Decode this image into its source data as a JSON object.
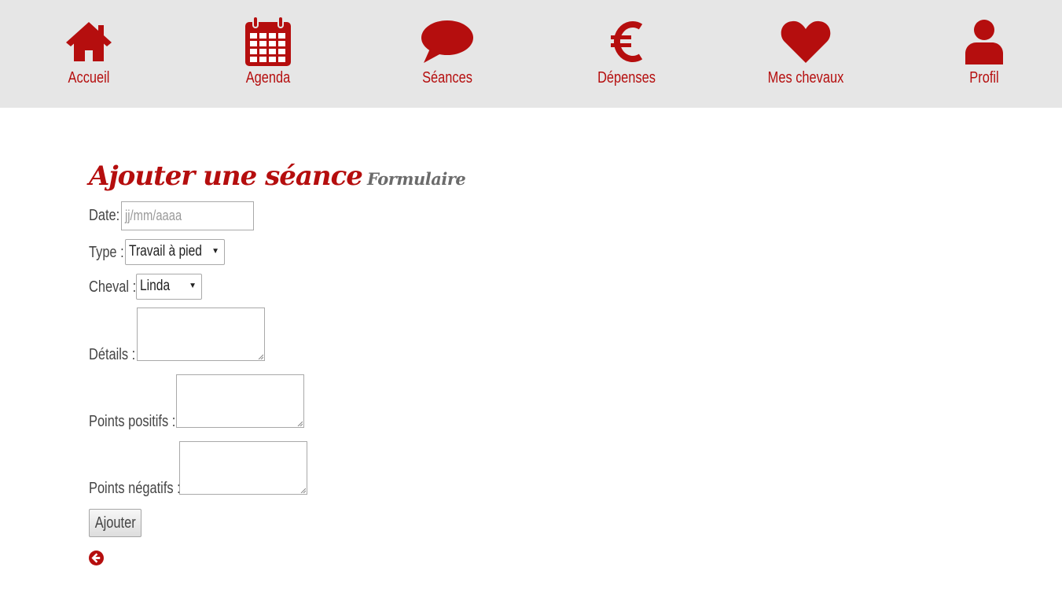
{
  "nav": {
    "items": [
      {
        "label": "Accueil",
        "icon": "home-icon"
      },
      {
        "label": "Agenda",
        "icon": "calendar-icon"
      },
      {
        "label": "Séances",
        "icon": "speech-bubble-icon"
      },
      {
        "label": "Dépenses",
        "icon": "euro-icon"
      },
      {
        "label": "Mes chevaux",
        "icon": "heart-icon"
      },
      {
        "label": "Profil",
        "icon": "user-icon"
      }
    ]
  },
  "page": {
    "title": "Ajouter une séance",
    "subtitle": "Formulaire"
  },
  "form": {
    "date_label": "Date:",
    "date_placeholder": "jj/mm/aaaa",
    "type_label": "Type :",
    "type_value": "Travail à pied",
    "cheval_label": "Cheval :",
    "cheval_value": "Linda",
    "details_label": "Détails :",
    "positifs_label": "Points positifs :",
    "negatifs_label": "Points négatifs :",
    "submit_label": "Ajouter",
    "back_icon": "arrow-circle-left-icon"
  },
  "colors": {
    "accent": "#b50e0e",
    "nav_background": "#e6e6e6"
  }
}
